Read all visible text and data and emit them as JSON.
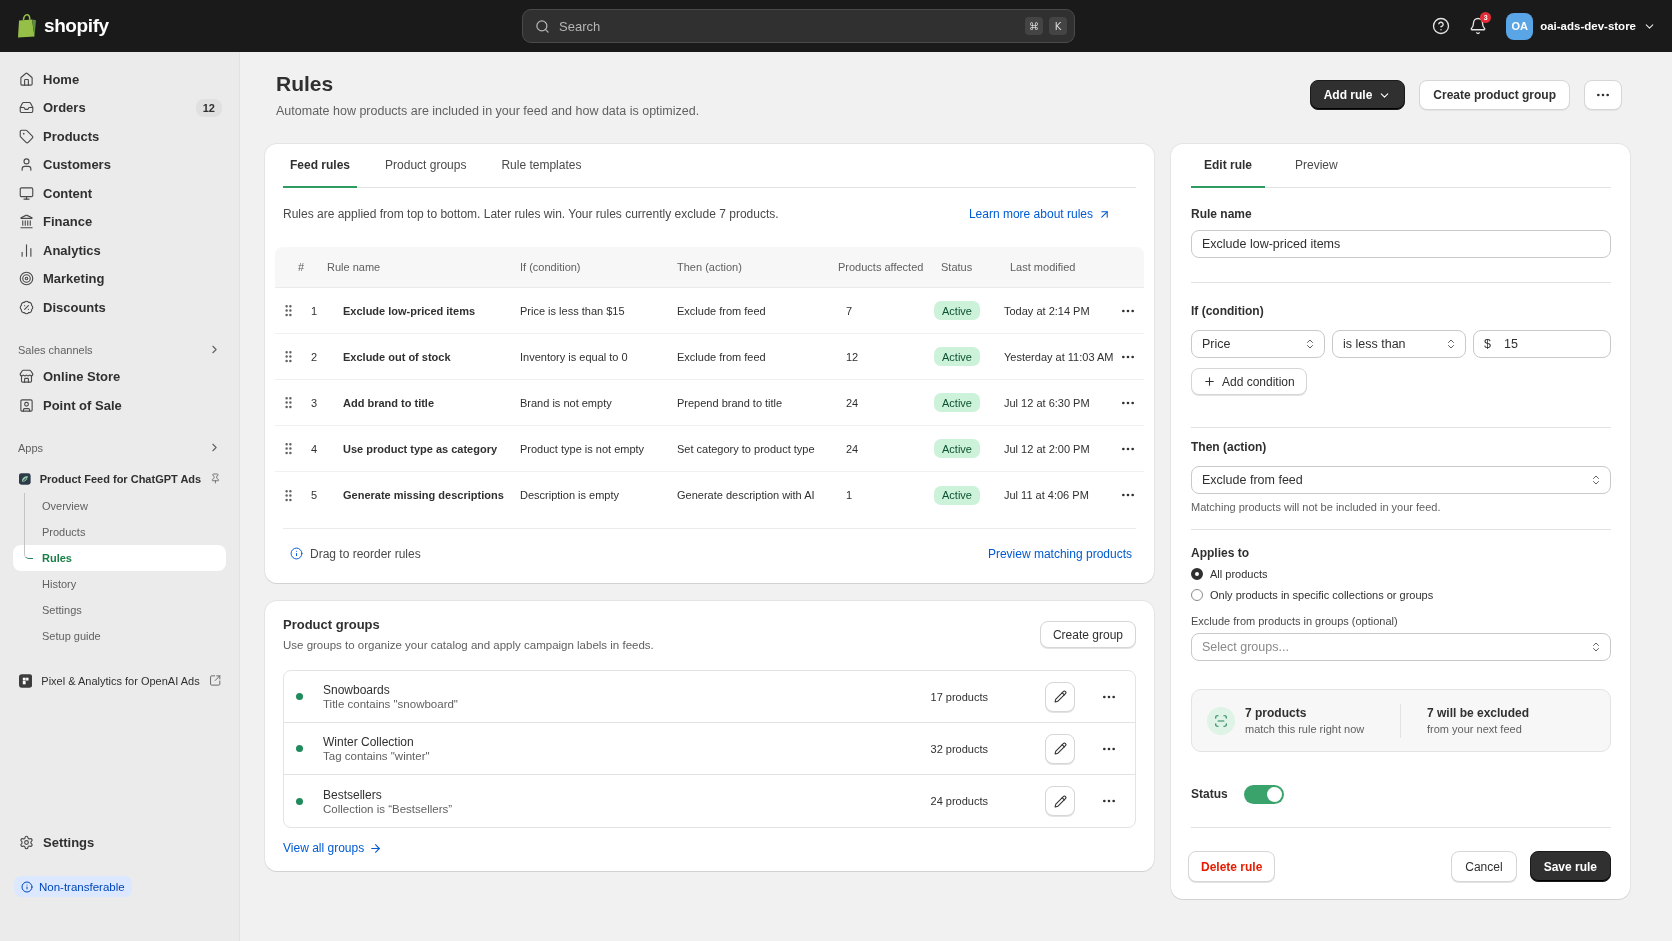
{
  "top_bar": {
    "logo": "shopify",
    "search": {
      "placeholder": "Search",
      "keys": [
        "⌘",
        "K"
      ]
    },
    "notifications": "3",
    "account": {
      "initials": "OA",
      "name": "oai-ads-dev-store"
    }
  },
  "sidebar": {
    "items": [
      {
        "label": "Home",
        "selected": false
      },
      {
        "label": "Orders",
        "selected": false,
        "count": "12"
      },
      {
        "label": "Products",
        "selected": false
      },
      {
        "label": "Customers",
        "selected": false
      },
      {
        "label": "Content",
        "selected": false
      },
      {
        "label": "Finance",
        "selected": false
      },
      {
        "label": "Analytics",
        "selected": false
      },
      {
        "label": "Marketing",
        "selected": false
      },
      {
        "label": "Discounts",
        "selected": false
      }
    ],
    "sections": [
      {
        "kind": "channels",
        "heading": "Sales channels",
        "items": [
          {
            "label": "Online Store",
            "selected": false
          },
          {
            "label": "Point of Sale",
            "selected": false
          }
        ]
      },
      {
        "kind": "apps",
        "heading": "Apps",
        "items": [
          {
            "label": "Product Feed for ChatGPT Ads",
            "selected": false,
            "expanded": true,
            "children": [
              {
                "label": "Overview",
                "selected": false
              },
              {
                "label": "Products",
                "selected": false
              },
              {
                "label": "Rules",
                "selected": true
              },
              {
                "label": "History",
                "selected": false
              },
              {
                "label": "Settings",
                "selected": false
              },
              {
                "label": "Setup guide",
                "selected": false
              }
            ]
          },
          {
            "label": "Pixel & Analytics for OpenAI Ads",
            "selected": false,
            "expanded": false
          }
        ]
      }
    ],
    "settings": {
      "label": "Settings",
      "selected": false
    },
    "notice": "Non-transferable"
  },
  "page": {
    "title": "Rules",
    "subtitle": "Automate how products are included in your feed and how data is optimized.",
    "actions": [
      {
        "label": "Add rule",
        "kind": "menu"
      },
      {
        "label": "Create product group",
        "kind": "plain"
      }
    ]
  },
  "rules_card": {
    "tabs": [
      {
        "label": "Feed rules",
        "selected": true
      },
      {
        "label": "Product groups",
        "selected": false
      },
      {
        "label": "Rule templates",
        "selected": false
      }
    ],
    "intro": "Rules are applied from top to bottom. Later rules win. Your rules currently exclude 7 products.",
    "learn_more": "Learn more about rules",
    "table": {
      "columns": [
        "#",
        "Rule name",
        "If (condition)",
        "Then (action)",
        "Products affected",
        "Status",
        "Last modified"
      ],
      "rows": [
        {
          "number": "1",
          "name": "Exclude low-priced items",
          "condition": "Price is less than $15",
          "action": "Exclude from feed",
          "affected": "7",
          "status": "Active",
          "modified": "Today at 2:14 PM"
        },
        {
          "number": "2",
          "name": "Exclude out of stock",
          "condition": "Inventory is equal to 0",
          "action": "Exclude from feed",
          "affected": "12",
          "status": "Active",
          "modified": "Yesterday at 11:03 AM"
        },
        {
          "number": "3",
          "name": "Add brand to title",
          "condition": "Brand is not empty",
          "action": "Prepend brand to title",
          "affected": "24",
          "status": "Active",
          "modified": "Jul 12 at 6:30 PM"
        },
        {
          "number": "4",
          "name": "Use product type as category",
          "condition": "Product type is not empty",
          "action": "Set category to product type",
          "affected": "24",
          "status": "Active",
          "modified": "Jul 12 at 2:00 PM"
        },
        {
          "number": "5",
          "name": "Generate missing descriptions",
          "condition": "Description is empty",
          "action": "Generate description with AI",
          "affected": "1",
          "status": "Active",
          "modified": "Jul 11 at 4:06 PM"
        }
      ]
    },
    "footer_hint": "Drag to reorder rules",
    "preview_link": "Preview matching products"
  },
  "groups_card": {
    "title": "Product groups",
    "subtitle": "Use groups to organize your catalog and apply campaign labels in feeds.",
    "create_button": "Create group",
    "groups": [
      {
        "name": "Snowboards",
        "rule": "Title contains \"snowboard\"",
        "count": "17 products"
      },
      {
        "name": "Winter Collection",
        "rule": "Tag contains \"winter\"",
        "count": "32 products"
      },
      {
        "name": "Bestsellers",
        "rule": "Collection is “Bestsellers”",
        "count": "24 products"
      }
    ],
    "view_all": "View all groups"
  },
  "editor": {
    "tabs": [
      {
        "label": "Edit rule",
        "selected": true
      },
      {
        "label": "Preview",
        "selected": false
      }
    ],
    "rule_name": {
      "label": "Rule name",
      "value": "Exclude low-priced items"
    },
    "condition": {
      "label": "If (condition)",
      "field": "Price",
      "operator": "is less than",
      "prefix": "$",
      "value": "15",
      "add_button": "Add condition"
    },
    "action": {
      "label": "Then (action)",
      "value": "Exclude from feed",
      "help": "Matching products will not be included in your feed."
    },
    "applies_to": {
      "label": "Applies to",
      "options": [
        {
          "label": "All products",
          "selected": true
        },
        {
          "label": "Only products in specific collections or groups",
          "selected": false
        }
      ]
    },
    "exclude_groups": {
      "label": "Exclude from products in groups (optional)",
      "placeholder": "Select groups..."
    },
    "summary": [
      {
        "value": "7 products",
        "caption": "match this rule right now"
      },
      {
        "value": "7 will be excluded",
        "caption": "from your next feed"
      }
    ],
    "status": {
      "label": "Status",
      "on": true
    },
    "buttons": {
      "delete": "Delete rule",
      "cancel": "Cancel",
      "save": "Save rule"
    }
  }
}
